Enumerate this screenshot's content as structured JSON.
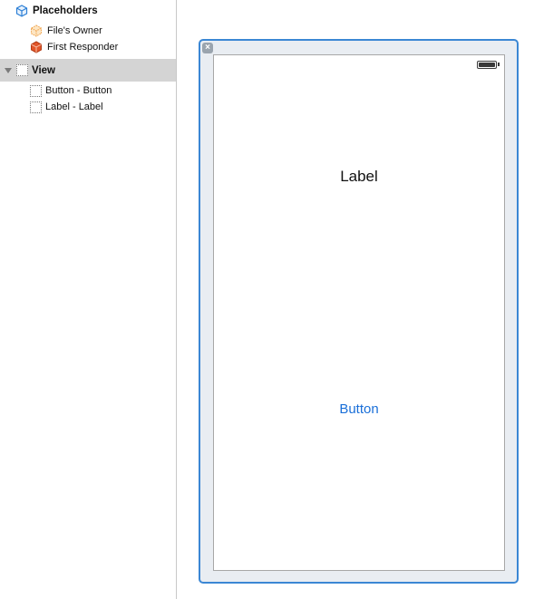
{
  "outline": {
    "placeholders_label": "Placeholders",
    "files_owner_label": "File's Owner",
    "first_responder_label": "First Responder",
    "view_label": "View",
    "button_item_label": "Button - Button",
    "label_item_label": "Label - Label"
  },
  "canvas": {
    "label_text": "Label",
    "button_text": "Button",
    "close_glyph": "×"
  },
  "colors": {
    "selection_border": "#3b87d4",
    "button_tint": "#1a6fd8",
    "selected_row_bg": "#d4d4d4"
  }
}
